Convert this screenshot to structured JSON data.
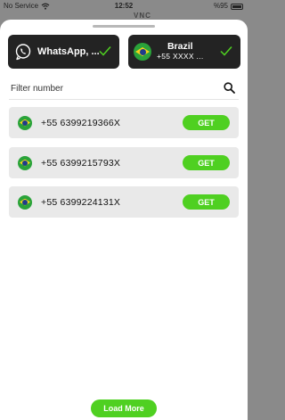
{
  "status_bar": {
    "carrier": "No Service",
    "time": "12:52",
    "battery": "%95"
  },
  "background": {
    "peek_logo": "VNC"
  },
  "service_selector": {
    "label": "WhatsApp, ...",
    "icon": "whatsapp-icon"
  },
  "country_selector": {
    "name": "Brazil",
    "code": "+55 XXXX ..."
  },
  "filter": {
    "placeholder": "Filter number",
    "value": ""
  },
  "numbers": [
    {
      "number": "+55 6399219366X",
      "action": "GET"
    },
    {
      "number": "+55 6399215793X",
      "action": "GET"
    },
    {
      "number": "+55 6399224131X",
      "action": "GET"
    }
  ],
  "load_more_label": "Load More",
  "colors": {
    "accent": "#4fd021",
    "selector_bg": "#232323",
    "row_bg": "#e9e9e9"
  }
}
